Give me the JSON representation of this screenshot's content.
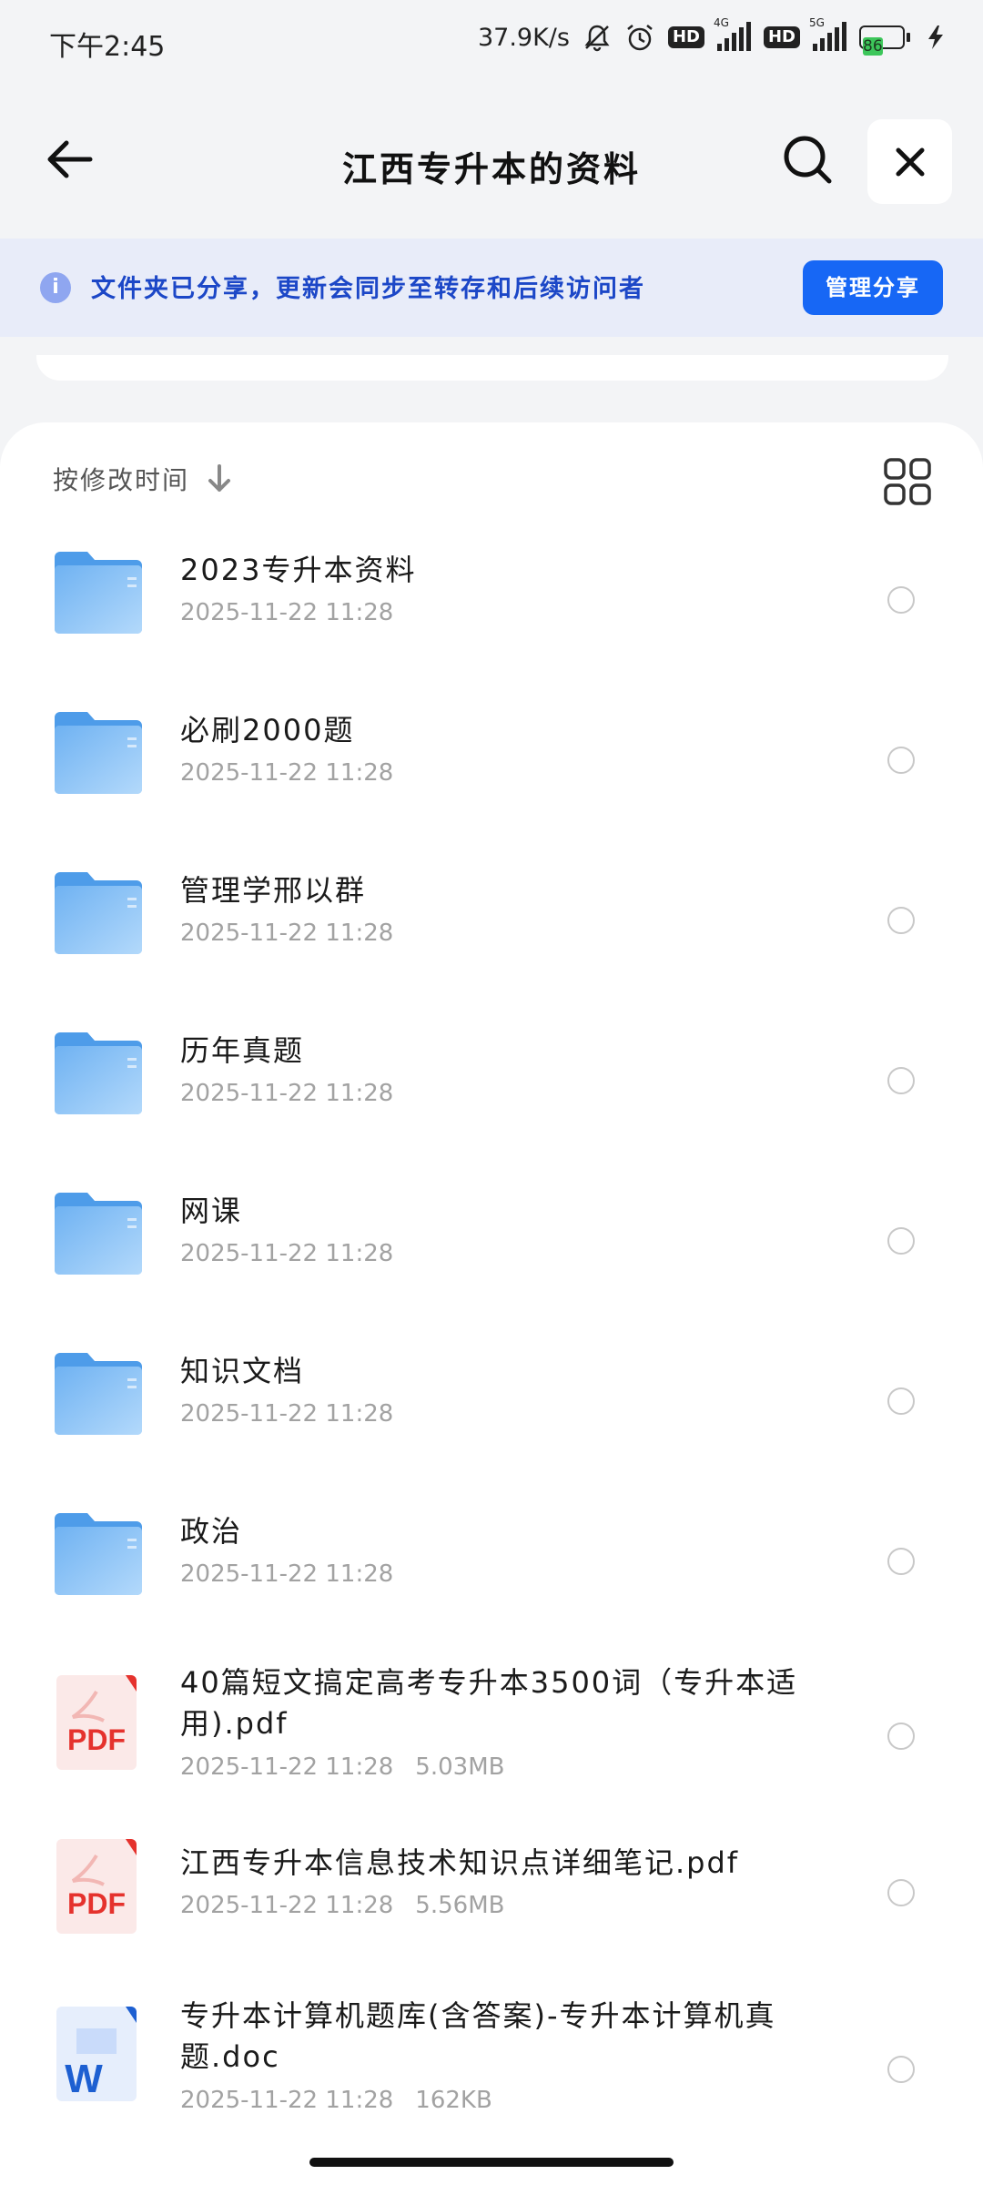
{
  "status_bar": {
    "time": "下午2:45",
    "network_speed": "37.9K/s",
    "hd1": "HD",
    "hd2": "HD",
    "net1": "4G",
    "net2": "5G",
    "battery": "86"
  },
  "header": {
    "title": "江西专升本的资料",
    "icons": [
      "back-arrow-icon",
      "search-icon",
      "close-icon"
    ]
  },
  "banner": {
    "icon": "i",
    "text": "文件夹已分享，更新会同步至转存和后续访问者",
    "button": "管理分享"
  },
  "sort": {
    "label": "按修改时间",
    "icon": "arrow-down-icon"
  },
  "colors": {
    "accent": "#1767f5",
    "folder": "#5aa8f0",
    "pdf": "#e5322d",
    "word": "#1d5fd1"
  },
  "items": [
    {
      "type": "folder",
      "name": "2023专升本资料",
      "date": "2025-11-22  11:28",
      "size": ""
    },
    {
      "type": "folder",
      "name": "必刷2000题",
      "date": "2025-11-22  11:28",
      "size": ""
    },
    {
      "type": "folder",
      "name": "管理学邢以群",
      "date": "2025-11-22  11:28",
      "size": ""
    },
    {
      "type": "folder",
      "name": "历年真题",
      "date": "2025-11-22  11:28",
      "size": ""
    },
    {
      "type": "folder",
      "name": "网课",
      "date": "2025-11-22  11:28",
      "size": ""
    },
    {
      "type": "folder",
      "name": "知识文档",
      "date": "2025-11-22  11:28",
      "size": ""
    },
    {
      "type": "folder",
      "name": "政治",
      "date": "2025-11-22  11:28",
      "size": ""
    },
    {
      "type": "pdf",
      "icon_label": "PDF",
      "name": "40篇短文搞定高考专升本3500词（专升本适用).pdf",
      "date": "2025-11-22  11:28",
      "size": "5.03MB"
    },
    {
      "type": "pdf",
      "icon_label": "PDF",
      "name": "江西专升本信息技术知识点详细笔记.pdf",
      "date": "2025-11-22  11:28",
      "size": "5.56MB"
    },
    {
      "type": "word",
      "icon_label": "W",
      "name": "专升本计算机题库(含答案)-专升本计算机真题.doc",
      "date": "2025-11-22  11:28",
      "size": "162KB"
    }
  ]
}
